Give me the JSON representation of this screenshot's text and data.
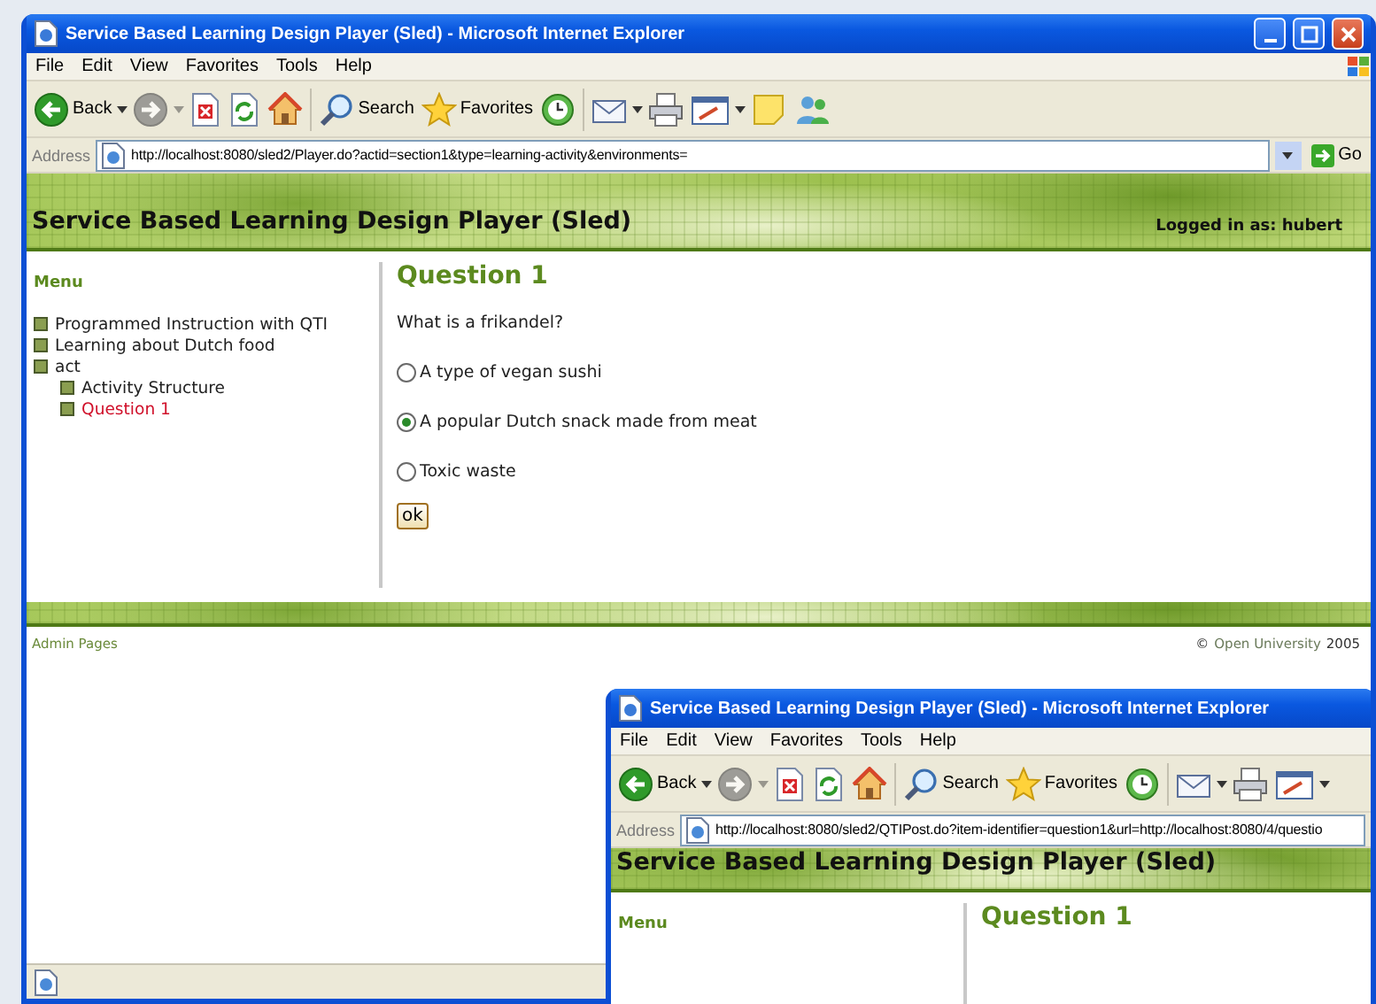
{
  "windows": [
    {
      "title": "Service Based Learning Design Player (Sled) - Microsoft Internet Explorer",
      "controls": true,
      "brand_logo": true,
      "status_bar": true,
      "menu": [
        "File",
        "Edit",
        "View",
        "Favorites",
        "Tools",
        "Help"
      ],
      "toolbar": [
        {
          "kind": "back",
          "label": "Back",
          "dropdown": true,
          "disabled": false
        },
        {
          "kind": "forward",
          "dropdown": true,
          "disabled": true
        },
        {
          "kind": "stop"
        },
        {
          "kind": "refresh"
        },
        {
          "kind": "home"
        },
        {
          "kind": "separator"
        },
        {
          "kind": "search",
          "label": "Search"
        },
        {
          "kind": "favorites",
          "label": "Favorites"
        },
        {
          "kind": "history"
        },
        {
          "kind": "separator"
        },
        {
          "kind": "mail",
          "dropdown": true
        },
        {
          "kind": "print"
        },
        {
          "kind": "edit",
          "dropdown": true
        },
        {
          "kind": "note"
        },
        {
          "kind": "messenger"
        }
      ],
      "address_label": "Address",
      "url": "http://localhost:8080/sled2/Player.do?actid=section1&type=learning-activity&environments=",
      "go_label": "Go",
      "page": {
        "site_title": "Service Based Learning Design Player (Sled)",
        "login": "Logged in as: hubert",
        "menu_heading": "Menu",
        "menu_items": [
          {
            "label": "Programmed Instruction with QTI",
            "selected": false
          },
          {
            "label": "Learning about Dutch food",
            "selected": false
          },
          {
            "label": "act",
            "selected": false,
            "children": [
              {
                "label": "Activity Structure",
                "selected": false
              },
              {
                "label": "Question 1",
                "selected": true
              }
            ]
          }
        ],
        "question_title": "Question 1",
        "prompt": "What is a frikandel?",
        "options": [
          {
            "label": "A type of vegan sushi",
            "selected": false
          },
          {
            "label": "A popular Dutch snack made from meat",
            "selected": true
          },
          {
            "label": "Toxic waste",
            "selected": false
          }
        ],
        "submit_label": "ok",
        "footer_left": "Admin Pages",
        "footer_right": {
          "symbol": "©",
          "link": "Open University",
          "year": "2005"
        }
      }
    },
    {
      "title": "Service Based Learning Design Player (Sled) - Microsoft Internet Explorer",
      "menu": [
        "File",
        "Edit",
        "View",
        "Favorites",
        "Tools",
        "Help"
      ],
      "toolbar": [
        {
          "kind": "back",
          "label": "Back",
          "dropdown": true,
          "disabled": false
        },
        {
          "kind": "forward",
          "dropdown": true,
          "disabled": true
        },
        {
          "kind": "stop"
        },
        {
          "kind": "refresh"
        },
        {
          "kind": "home"
        },
        {
          "kind": "separator"
        },
        {
          "kind": "search",
          "label": "Search"
        },
        {
          "kind": "favorites",
          "label": "Favorites"
        },
        {
          "kind": "history"
        },
        {
          "kind": "separator"
        },
        {
          "kind": "mail",
          "dropdown": true
        },
        {
          "kind": "print"
        },
        {
          "kind": "edit",
          "dropdown": true
        }
      ],
      "address_label": "Address",
      "url": "http://localhost:8080/sled2/QTIPost.do?item-identifier=question1&url=http://localhost:8080/4/questio",
      "page": {
        "site_title": "Service Based Learning Design Player (Sled)",
        "menu_heading": "Menu",
        "question_title": "Question 1"
      }
    }
  ]
}
